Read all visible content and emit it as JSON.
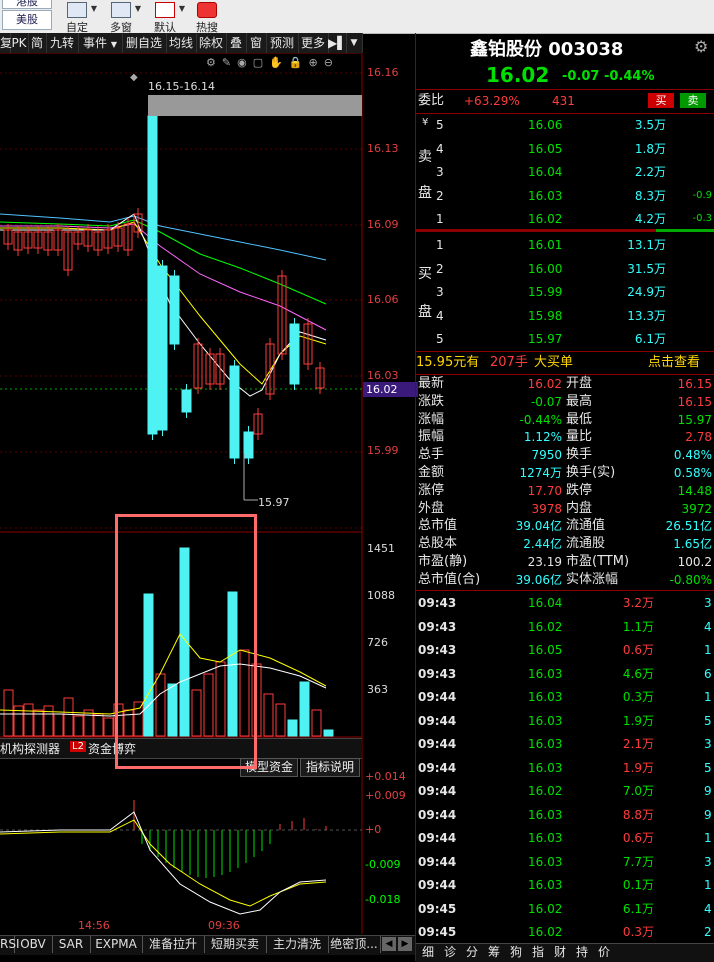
{
  "toolbar": {
    "market_tab_a": "港股",
    "market_tab_b": "美股",
    "buttons": [
      "自定",
      "多窗",
      "默认",
      "热搜"
    ]
  },
  "chart_toolbar": {
    "items": [
      "复",
      "PK",
      "简",
      "九转",
      "事件",
      "删自选",
      "均线",
      "除权",
      "叠",
      "窗",
      "预测",
      "更多"
    ]
  },
  "price_chart": {
    "range_label": "16.15-16.14",
    "low_label": "15.97",
    "yticks": [
      "16.16",
      "16.13",
      "16.09",
      "16.06",
      "16.03",
      "15.99"
    ],
    "current": "16.02",
    "colors": {
      "up": "#ff3c3c",
      "down": "#4ff2f2",
      "ma5": "#ffffff",
      "ma10": "#ffff00",
      "ma20": "#ff66ff",
      "ma30": "#00ff00",
      "ma60": "#4fc3ff"
    }
  },
  "volume_chart": {
    "yticks": [
      "1451",
      "1088",
      "726",
      "363"
    ]
  },
  "indicator_bar": {
    "tabs": [
      "机构探测器",
      "资金博弈"
    ],
    "badge": "L2",
    "buttons": [
      "模型资金",
      "指标说明"
    ]
  },
  "macd": {
    "yticks": [
      "+0.014",
      "+0.009",
      "+0",
      "-0.009",
      "-0.018"
    ]
  },
  "time_axis": [
    "14:56",
    "09:36"
  ],
  "bottom_tabs": [
    "RSI",
    "OBV",
    "SAR",
    "EXPMA",
    "准备拉升",
    "短期买卖",
    "主力清洗",
    "绝密顶..."
  ],
  "stock": {
    "name": "鑫铂股份",
    "code": "003038",
    "price": "16.02",
    "change": "-0.07",
    "pct": "-0.44%"
  },
  "weibi": {
    "label": "委比",
    "value": "+63.29%",
    "diff": "431",
    "sell_btn": "买",
    "buy_btn": "卖"
  },
  "ask": [
    {
      "lvl": "5",
      "price": "16.06",
      "vol": "3.5万",
      "chg": ""
    },
    {
      "lvl": "4",
      "price": "16.05",
      "vol": "1.8万",
      "chg": ""
    },
    {
      "lvl": "3",
      "price": "16.04",
      "vol": "2.2万",
      "chg": ""
    },
    {
      "lvl": "2",
      "price": "16.03",
      "vol": "8.3万",
      "chg": "-0.9"
    },
    {
      "lvl": "1",
      "price": "16.02",
      "vol": "4.2万",
      "chg": "-0.3"
    }
  ],
  "ask_label": [
    "卖",
    "盘"
  ],
  "bid": [
    {
      "lvl": "1",
      "price": "16.01",
      "vol": "13.1万"
    },
    {
      "lvl": "2",
      "price": "16.00",
      "vol": "31.5万"
    },
    {
      "lvl": "3",
      "price": "15.99",
      "vol": "24.9万"
    },
    {
      "lvl": "4",
      "price": "15.98",
      "vol": "13.3万"
    },
    {
      "lvl": "5",
      "price": "15.97",
      "vol": "6.1万"
    }
  ],
  "bid_label": [
    "买",
    "盘"
  ],
  "big_order": {
    "price": "15.95元有",
    "vol": "207手",
    "type": "大买单",
    "link": "点击查看"
  },
  "stats": [
    {
      "k1": "最新",
      "v1": "16.02",
      "c1": "red",
      "k2": "开盘",
      "v2": "16.15",
      "c2": "red"
    },
    {
      "k1": "涨跌",
      "v1": "-0.07",
      "c1": "green",
      "k2": "最高",
      "v2": "16.15",
      "c2": "red"
    },
    {
      "k1": "涨幅",
      "v1": "-0.44%",
      "c1": "green",
      "k2": "最低",
      "v2": "15.97",
      "c2": "green"
    },
    {
      "k1": "振幅",
      "v1": "1.12%",
      "c1": "cyan",
      "k2": "量比",
      "v2": "2.78",
      "c2": "red"
    },
    {
      "k1": "总手",
      "v1": "7950",
      "c1": "cyan",
      "k2": "换手",
      "v2": "0.48%",
      "c2": "cyan"
    },
    {
      "k1": "金额",
      "v1": "1274万",
      "c1": "cyan",
      "k2": "换手(实)",
      "v2": "0.58%",
      "c2": "cyan"
    },
    {
      "k1": "涨停",
      "v1": "17.70",
      "c1": "red",
      "k2": "跌停",
      "v2": "14.48",
      "c2": "green"
    },
    {
      "k1": "外盘",
      "v1": "3978",
      "c1": "red",
      "k2": "内盘",
      "v2": "3972",
      "c2": "green"
    },
    {
      "k1": "总市值",
      "v1": "39.04亿",
      "c1": "cyan",
      "k2": "流通值",
      "v2": "26.51亿",
      "c2": "cyan"
    },
    {
      "k1": "总股本",
      "v1": "2.44亿",
      "c1": "cyan",
      "k2": "流通股",
      "v2": "1.65亿",
      "c2": "cyan"
    },
    {
      "k1": "市盈(静)",
      "v1": "23.19",
      "c1": "white",
      "k2": "市盈(TTM)",
      "v2": "100.2",
      "c2": "white"
    },
    {
      "k1": "总市值(合)",
      "v1": "39.06亿",
      "c1": "cyan",
      "k2": "实体涨幅",
      "v2": "-0.80%",
      "c2": "green"
    }
  ],
  "ticks": [
    {
      "t": "09:43",
      "p": "16.04",
      "pc": "green",
      "v": "3.2万",
      "vc": "red",
      "n": "3"
    },
    {
      "t": "09:43",
      "p": "16.02",
      "pc": "green",
      "v": "1.1万",
      "vc": "green",
      "n": "4"
    },
    {
      "t": "09:43",
      "p": "16.05",
      "pc": "green",
      "v": "0.6万",
      "vc": "red",
      "n": "1"
    },
    {
      "t": "09:43",
      "p": "16.03",
      "pc": "green",
      "v": "4.6万",
      "vc": "green",
      "n": "6"
    },
    {
      "t": "09:44",
      "p": "16.03",
      "pc": "green",
      "v": "0.3万",
      "vc": "green",
      "n": "1"
    },
    {
      "t": "09:44",
      "p": "16.03",
      "pc": "green",
      "v": "1.9万",
      "vc": "green",
      "n": "5"
    },
    {
      "t": "09:44",
      "p": "16.03",
      "pc": "green",
      "v": "2.1万",
      "vc": "red",
      "n": "3"
    },
    {
      "t": "09:44",
      "p": "16.03",
      "pc": "green",
      "v": "1.9万",
      "vc": "red",
      "n": "5"
    },
    {
      "t": "09:44",
      "p": "16.02",
      "pc": "green",
      "v": "7.0万",
      "vc": "green",
      "n": "9"
    },
    {
      "t": "09:44",
      "p": "16.03",
      "pc": "green",
      "v": "8.8万",
      "vc": "red",
      "n": "9"
    },
    {
      "t": "09:44",
      "p": "16.03",
      "pc": "green",
      "v": "0.6万",
      "vc": "red",
      "n": "1"
    },
    {
      "t": "09:44",
      "p": "16.03",
      "pc": "green",
      "v": "7.7万",
      "vc": "green",
      "n": "3"
    },
    {
      "t": "09:44",
      "p": "16.03",
      "pc": "green",
      "v": "0.1万",
      "vc": "green",
      "n": "1"
    },
    {
      "t": "09:45",
      "p": "16.02",
      "pc": "green",
      "v": "6.1万",
      "vc": "green",
      "n": "4"
    },
    {
      "t": "09:45",
      "p": "16.02",
      "pc": "green",
      "v": "0.3万",
      "vc": "red",
      "n": "2"
    }
  ],
  "quote_tabs": [
    "细",
    "诊",
    "分",
    "筹",
    "狗",
    "指",
    "财",
    "持",
    "价"
  ]
}
